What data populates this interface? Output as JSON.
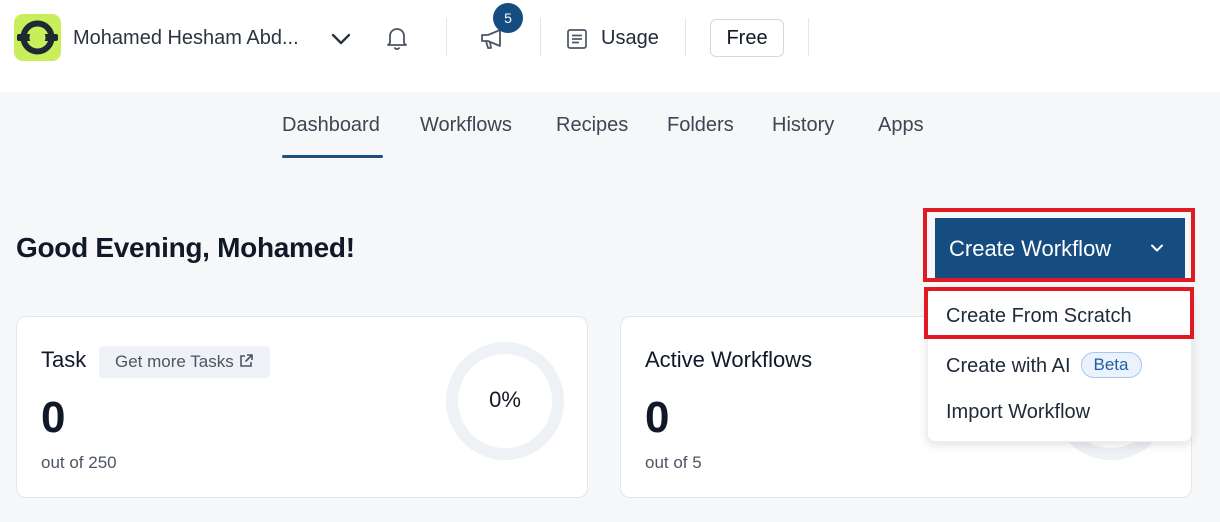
{
  "header": {
    "user_name": "Mohamed Hesham Abd...",
    "notification_count": "5",
    "usage_label": "Usage",
    "plan_label": "Free"
  },
  "nav": {
    "tabs": [
      "Dashboard",
      "Workflows",
      "Recipes",
      "Folders",
      "History",
      "Apps"
    ],
    "active": "Dashboard"
  },
  "greeting": "Good Evening, Mohamed!",
  "create_workflow": {
    "label": "Create Workflow",
    "menu": {
      "from_scratch": "Create From Scratch",
      "with_ai": "Create with AI",
      "ai_badge": "Beta",
      "import": "Import Workflow"
    }
  },
  "cards": {
    "task": {
      "title": "Task",
      "link": "Get more Tasks",
      "value": "0",
      "sub": "out of 250",
      "percent": "0%",
      "progress_fraction": 0
    },
    "active": {
      "title": "Active Workflows",
      "value": "0",
      "sub": "out of 5"
    }
  },
  "colors": {
    "brand_blue": "#164d80",
    "logo_green": "#c8ef5a",
    "highlight_red": "#e01a22"
  },
  "icons": {
    "logo": "ring-logo-icon",
    "chevron": "chevron-down-icon",
    "bell": "bell-icon",
    "megaphone": "megaphone-icon",
    "usage": "document-lines-icon",
    "external": "external-link-icon"
  }
}
